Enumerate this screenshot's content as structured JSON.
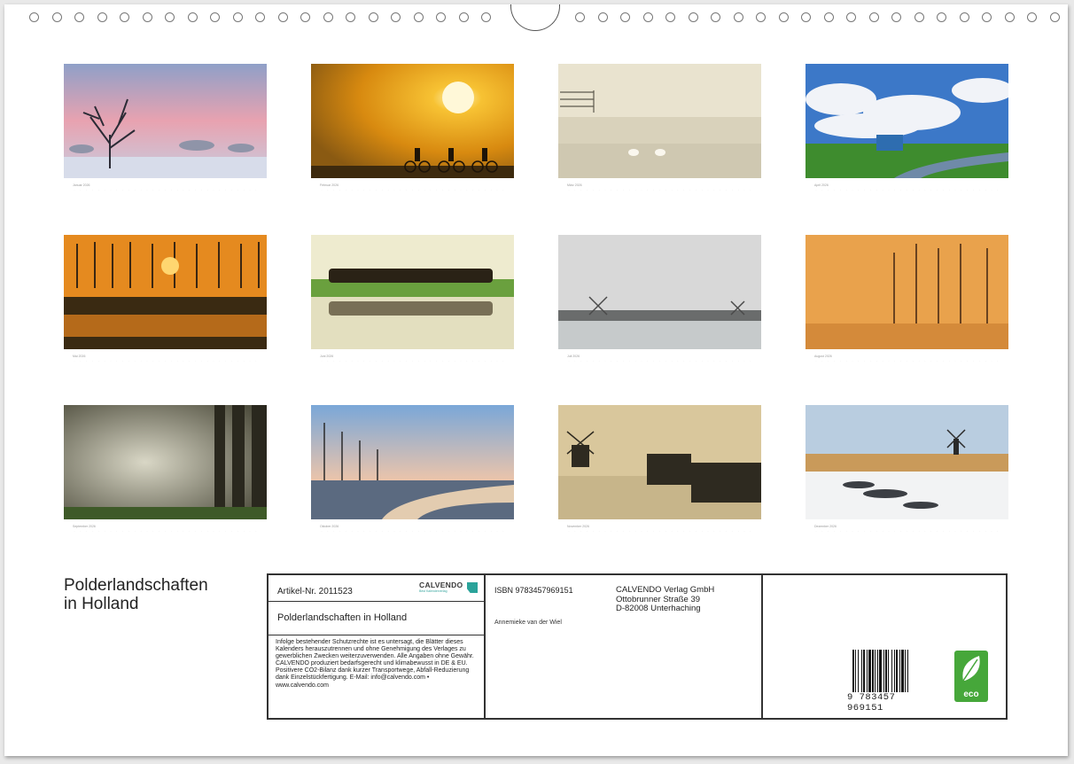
{
  "calendar": {
    "title_line1": "Polderlandschaften",
    "title_line2": "in Holland",
    "months": [
      {
        "label": "Januar 2026"
      },
      {
        "label": "Februar 2026"
      },
      {
        "label": "März 2026"
      },
      {
        "label": "April 2026"
      },
      {
        "label": "Mai 2026"
      },
      {
        "label": "Juni 2026"
      },
      {
        "label": "Juli 2026"
      },
      {
        "label": "August 2026"
      },
      {
        "label": "September 2026"
      },
      {
        "label": "Oktober 2026"
      },
      {
        "label": "November 2026"
      },
      {
        "label": "Dezember 2026"
      }
    ]
  },
  "info": {
    "artikel": "Artikel-Nr. 2011523",
    "logo_text": "CALVENDO",
    "logo_sub": "Best Kalenderverlag",
    "book_title": "Polderlandschaften in Holland",
    "legal_text": "Infolge bestehender Schutzrechte ist es untersagt, die Blätter dieses Kalenders herauszutrennen und ohne Genehmigung des Verlages zu gewerblichen Zwecken weiterzuverwenden. Alle Angaben ohne Gewähr. CALVENDO produziert bedarfsgerecht und klimabewusst in DE & EU. Positivere CO2-Bilanz dank kurzer Transportwege, Abfall-Reduzierung dank Einzelstückfertigung. E-Mail: info@calvendo.com • www.calvendo.com",
    "isbn": "ISBN 9783457969151",
    "publisher_line1": "CALVENDO Verlag GmbH",
    "publisher_line2": "Ottobrunner Straße 39",
    "publisher_line3": "D-82008 Unterhaching",
    "author": "Annemieke van der Wiel",
    "barcode_number": "9 783457 969151",
    "eco_label": "eco"
  }
}
